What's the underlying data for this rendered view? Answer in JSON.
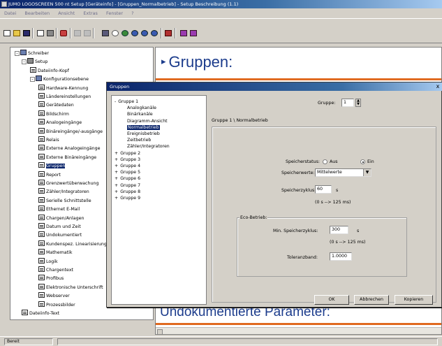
{
  "window": {
    "title": "JUMO LOGOSCREEN 500 nt Setup [Geräteinfo] - [Gruppen_Normalbetrieb] - Setup Beschreibung (1.1)"
  },
  "menu": {
    "items": [
      "Datei",
      "Bearbeiten",
      "Ansicht",
      "Extras",
      "Fenster",
      "?"
    ]
  },
  "toolbar": {
    "buttons": [
      "new",
      "open",
      "save",
      "print-preview",
      "print",
      "wizard",
      "cut",
      "copy",
      "paste",
      "find",
      "settings",
      "connect",
      "send",
      "receive",
      "transfer",
      "help",
      "list",
      "window"
    ]
  },
  "tree": {
    "nodes": [
      {
        "label": "Schreiber",
        "level": 0,
        "icon": "folder-icon",
        "expander": "-"
      },
      {
        "label": "Setup",
        "level": 1,
        "icon": "book-icon",
        "expander": "-"
      },
      {
        "label": "Dateiinfo-Kopf",
        "level": 2,
        "icon": "doc-icon"
      },
      {
        "label": "Konfigurationsebene",
        "level": 2,
        "icon": "folder-icon",
        "expander": "-"
      },
      {
        "label": "Hardware-Kennung",
        "level": 3,
        "icon": "doc-icon"
      },
      {
        "label": "Ländereinstellungen",
        "level": 3,
        "icon": "doc-icon"
      },
      {
        "label": "Gerätedaten",
        "level": 3,
        "icon": "doc-icon"
      },
      {
        "label": "Bildschirm",
        "level": 3,
        "icon": "doc-icon"
      },
      {
        "label": "Analogeingänge",
        "level": 3,
        "icon": "doc-icon"
      },
      {
        "label": "Binäreingänge/-ausgänge",
        "level": 3,
        "icon": "doc-icon"
      },
      {
        "label": "Relais",
        "level": 3,
        "icon": "doc-icon"
      },
      {
        "label": "Externe Analogeingänge",
        "level": 3,
        "icon": "doc-icon"
      },
      {
        "label": "Externe Binäreingänge",
        "level": 3,
        "icon": "doc-icon"
      },
      {
        "label": "Gruppen",
        "level": 3,
        "icon": "doc-icon",
        "selected": true
      },
      {
        "label": "Report",
        "level": 3,
        "icon": "doc-icon"
      },
      {
        "label": "Grenzwertüberwachung",
        "level": 3,
        "icon": "doc-icon"
      },
      {
        "label": "Zähler/Integratoren",
        "level": 3,
        "icon": "doc-icon"
      },
      {
        "label": "Serielle Schnittstelle",
        "level": 3,
        "icon": "doc-icon"
      },
      {
        "label": "Ethernet E-Mail",
        "level": 3,
        "icon": "doc-icon"
      },
      {
        "label": "Chargen/Anlagen",
        "level": 3,
        "icon": "doc-icon"
      },
      {
        "label": "Datum und Zeit",
        "level": 3,
        "icon": "doc-icon"
      },
      {
        "label": "Undokumentiert",
        "level": 3,
        "icon": "doc-icon"
      },
      {
        "label": "Kundenspez. Linearisierung",
        "level": 3,
        "icon": "doc-icon"
      },
      {
        "label": "Mathematik",
        "level": 3,
        "icon": "doc-icon"
      },
      {
        "label": "Logik",
        "level": 3,
        "icon": "doc-icon"
      },
      {
        "label": "Chargentext",
        "level": 3,
        "icon": "doc-icon"
      },
      {
        "label": "Profibus",
        "level": 3,
        "icon": "doc-icon"
      },
      {
        "label": "Elektronische Unterschrift",
        "level": 3,
        "icon": "doc-icon"
      },
      {
        "label": "Webserver",
        "level": 3,
        "icon": "doc-icon"
      },
      {
        "label": "Prozessbilder",
        "level": 3,
        "icon": "doc-icon"
      },
      {
        "label": "Dateiinfo-Text",
        "level": 1,
        "icon": "doc-icon"
      }
    ]
  },
  "content": {
    "heading": "Gruppen:",
    "bottom_heading": "Undokumentierte Parameter:"
  },
  "statusbar": {
    "text": "Bereit"
  },
  "dialog": {
    "title": "Gruppen",
    "close": "x",
    "tree": [
      {
        "label": "Gruppe 1",
        "expander": "-",
        "sub": false
      },
      {
        "label": "Analogkanäle",
        "sub": true
      },
      {
        "label": "Binärkanäle",
        "sub": true
      },
      {
        "label": "Diagramm-Ansicht",
        "sub": true
      },
      {
        "label": "Normalbetrieb",
        "sub": true,
        "selected": true
      },
      {
        "label": "Ereignisbetrieb",
        "sub": true
      },
      {
        "label": "Zeitbetrieb",
        "sub": true
      },
      {
        "label": "Zähler/Integratoren",
        "sub": true
      },
      {
        "label": "Gruppe 2",
        "expander": "+",
        "sub": false
      },
      {
        "label": "Gruppe 3",
        "expander": "+",
        "sub": false
      },
      {
        "label": "Gruppe 4",
        "expander": "+",
        "sub": false
      },
      {
        "label": "Gruppe 5",
        "expander": "+",
        "sub": false
      },
      {
        "label": "Gruppe 6",
        "expander": "+",
        "sub": false
      },
      {
        "label": "Gruppe 7",
        "expander": "+",
        "sub": false
      },
      {
        "label": "Gruppe 8",
        "expander": "+",
        "sub": false
      },
      {
        "label": "Gruppe 9",
        "expander": "+",
        "sub": false
      }
    ],
    "gruppe_label": "Gruppe:",
    "gruppe_value": "1",
    "section_title": "Gruppe 1 \\ Normalbetrieb",
    "speicherstatus_label": "Speicherstatus:",
    "radio_aus": "Aus",
    "radio_ein": "Ein",
    "speicherwerte_label": "Speicherwerte:",
    "speicherwerte_value": "Mittelwerte",
    "speicherzyklus_label": "Speicherzyklus:",
    "speicherzyklus_value": "60",
    "speicherzyklus_unit": "s",
    "speicherzyklus_range": "(0 s --> 125 ms)",
    "eco_label": "Eco-Betrieb:",
    "min_speicherzyklus_label": "Min. Speicherzyklus:",
    "min_speicherzyklus_value": "300",
    "min_speicherzyklus_unit": "s",
    "min_speicherzyklus_range": "(0 s --> 125 ms)",
    "toleranzband_label": "Toleranzband:",
    "toleranzband_value": "1.0000",
    "btn_ok": "OK",
    "btn_abbrechen": "Abbrechen",
    "btn_kopieren": "Kopieren"
  },
  "colors": {
    "title_blue": "#0a246a",
    "heading_blue": "#1c3c8c",
    "accent_orange": "#e06a20",
    "face": "#d4d0c8"
  }
}
